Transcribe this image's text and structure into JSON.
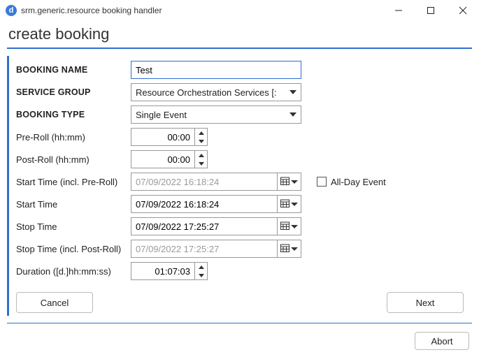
{
  "window": {
    "title": "srm.generic.resource booking handler",
    "app_icon_letter": "d"
  },
  "page": {
    "title": "create booking"
  },
  "labels": {
    "booking_name": "BOOKING NAME",
    "service_group": "SERVICE GROUP",
    "booking_type": "BOOKING TYPE",
    "pre_roll": "Pre-Roll (hh:mm)",
    "post_roll": "Post-Roll (hh:mm)",
    "start_incl": "Start Time (incl. Pre-Roll)",
    "start_time": "Start Time",
    "stop_time": "Stop Time",
    "stop_incl": "Stop Time (incl. Post-Roll)",
    "duration": "Duration ([d.]hh:mm:ss)",
    "all_day": "All-Day Event"
  },
  "fields": {
    "booking_name": "Test",
    "service_group": "Resource Orchestration Services [:",
    "booking_type": "Single Event",
    "pre_roll": "00:00",
    "post_roll": "00:00",
    "start_incl": "07/09/2022 16:18:24",
    "start_time": "07/09/2022 16:18:24",
    "stop_time": "07/09/2022 17:25:27",
    "stop_incl": "07/09/2022 17:25:27",
    "duration": "01:07:03",
    "all_day_checked": false
  },
  "buttons": {
    "cancel": "Cancel",
    "next": "Next",
    "abort": "Abort"
  }
}
